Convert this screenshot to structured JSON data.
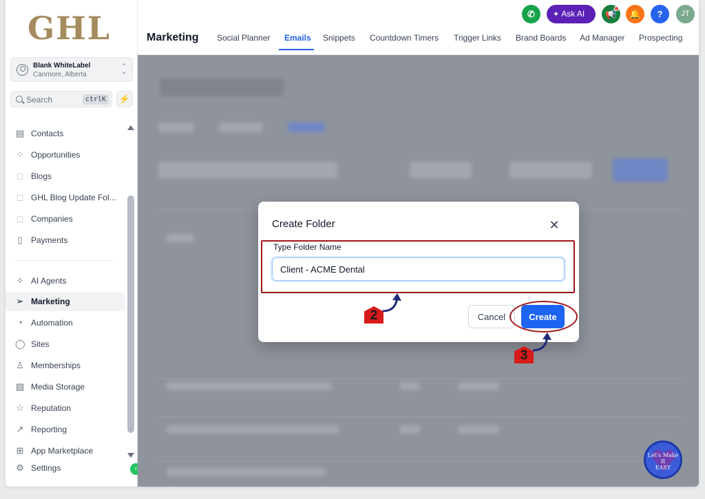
{
  "brand": {
    "logo_text": "GHL",
    "accent": "#2563eb",
    "logo_color": "#a58c5e"
  },
  "account": {
    "name": "Blank WhiteLabel",
    "location": "Canmore, Alberta"
  },
  "search": {
    "placeholder": "Search",
    "shortcut": "ctrlK"
  },
  "sidebar": {
    "items": [
      {
        "label": "Contacts",
        "icon": "contacts-icon"
      },
      {
        "label": "Opportunities",
        "icon": "opportunities-icon"
      },
      {
        "label": "Blogs",
        "icon": "blogs-icon"
      },
      {
        "label": "GHL Blog Update Fol...",
        "icon": "folder-icon"
      },
      {
        "label": "Companies",
        "icon": "companies-icon"
      },
      {
        "label": "Payments",
        "icon": "payments-icon"
      },
      {
        "label": "AI Agents",
        "icon": "ai-agents-icon"
      },
      {
        "label": "Marketing",
        "icon": "marketing-icon",
        "active": true
      },
      {
        "label": "Automation",
        "icon": "automation-icon"
      },
      {
        "label": "Sites",
        "icon": "sites-icon"
      },
      {
        "label": "Memberships",
        "icon": "memberships-icon"
      },
      {
        "label": "Media Storage",
        "icon": "media-storage-icon"
      },
      {
        "label": "Reputation",
        "icon": "reputation-icon"
      },
      {
        "label": "Reporting",
        "icon": "reporting-icon"
      },
      {
        "label": "App Marketplace",
        "icon": "app-marketplace-icon"
      },
      {
        "label": "Settings",
        "icon": "settings-icon"
      }
    ]
  },
  "header": {
    "title": "Marketing",
    "tabs": [
      {
        "label": "Social Planner"
      },
      {
        "label": "Emails",
        "active": true
      },
      {
        "label": "Snippets"
      },
      {
        "label": "Countdown Timers"
      },
      {
        "label": "Trigger Links"
      },
      {
        "label": "Brand Boards"
      },
      {
        "label": "Ad Manager"
      },
      {
        "label": "Prospecting"
      }
    ],
    "ask_ai_label": "Ask AI",
    "help_label": "?",
    "user_initials": "JT"
  },
  "modal": {
    "title": "Create Folder",
    "field_label": "Type Folder Name",
    "field_value": "Client - ACME Dental",
    "cancel_label": "Cancel",
    "create_label": "Create"
  },
  "annotations": {
    "step_2": "2",
    "step_3": "3"
  },
  "watermark": {
    "line1": "Let's Make",
    "line2": "It",
    "line3": "EASY"
  }
}
